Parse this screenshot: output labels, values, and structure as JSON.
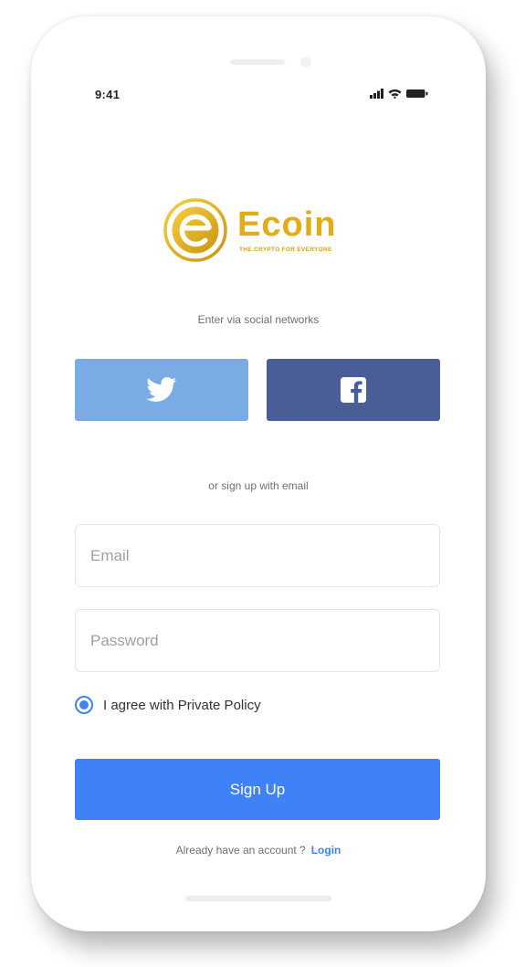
{
  "status_bar": {
    "time": "9:41",
    "signal_icon": "cellular-signal-icon",
    "wifi_icon": "wifi-icon",
    "battery_icon": "battery-icon"
  },
  "brand": {
    "name": "Ecoin",
    "tagline": "THE CRYPTO FOR EVERYONE",
    "logo_icon": "ecoin-coin-logo",
    "color": "#e1ab19"
  },
  "social": {
    "caption": "Enter via social networks",
    "twitter": {
      "icon": "twitter-bird-icon",
      "color": "#7aabe5"
    },
    "facebook": {
      "icon": "facebook-f-icon",
      "color": "#495d96"
    }
  },
  "email_divider": "or sign up with email",
  "form": {
    "email_placeholder": "Email",
    "password_placeholder": "Password",
    "agree_label": "I agree with Private Policy",
    "agree_checked": true,
    "submit_label": "Sign Up"
  },
  "footer": {
    "prompt": "Already have an account ?",
    "login_link": "Login"
  },
  "colors": {
    "accent": "#3f82f7"
  }
}
